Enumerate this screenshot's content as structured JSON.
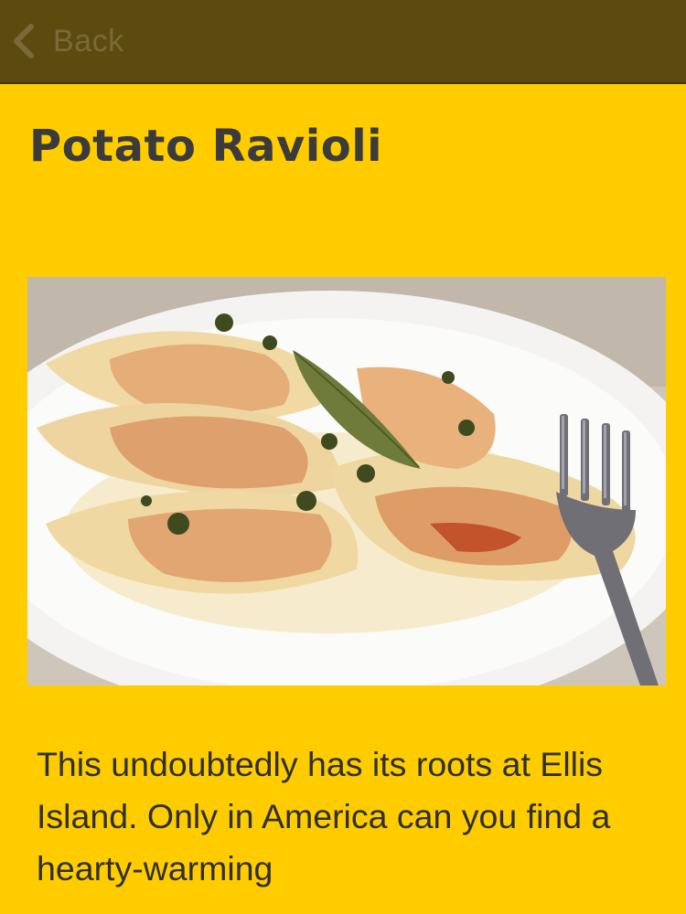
{
  "nav": {
    "back_label": "Back",
    "back_icon": "chevron-left-icon"
  },
  "recipe": {
    "title": "Potato Ravioli",
    "image_subject": "ravioli with sage and brown butter on white plate with fork",
    "description": "This undoubtedly has its roots at Ellis Island. Only in America can you find a hearty-warming"
  },
  "colors": {
    "background": "#FFCC00",
    "topbar": "#5C4A0F",
    "title": "#3b3b3b",
    "body_text": "#2f2f2f",
    "back_text": "#7a6a3a"
  }
}
